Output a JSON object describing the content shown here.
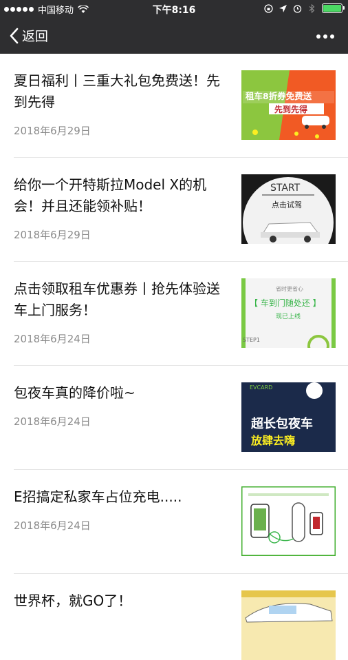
{
  "status_bar": {
    "carrier": "中国移动",
    "time": "下午8:16"
  },
  "nav": {
    "back_label": "返回"
  },
  "articles": [
    {
      "title": "夏日福利丨三重大礼包免费送！先到先得",
      "date": "2018年6月29日",
      "thumb_text": [
        "租车8折券免费送",
        "先到先得"
      ]
    },
    {
      "title": "给你一个开特斯拉Model X的机会！并且还能领补贴！",
      "date": "2018年6月29日",
      "thumb_text": [
        "START",
        "点击试驾"
      ]
    },
    {
      "title": "点击领取租车优惠券丨抢先体验送车上门服务！",
      "date": "2018年6月24日",
      "thumb_text": [
        "省时更省心",
        "【 车到门随处还 】",
        "现已上线",
        "STEP1"
      ]
    },
    {
      "title": "包夜车真的降价啦~",
      "date": "2018年6月24日",
      "thumb_text": [
        "EVCARD",
        "超长包夜车",
        "放肆去嗨"
      ]
    },
    {
      "title": "E招搞定私家车占位充电.....",
      "date": "2018年6月24日",
      "thumb_text": [
        "",
        ""
      ]
    },
    {
      "title": "世界杯，就GO了！",
      "date": "",
      "thumb_text": []
    }
  ]
}
